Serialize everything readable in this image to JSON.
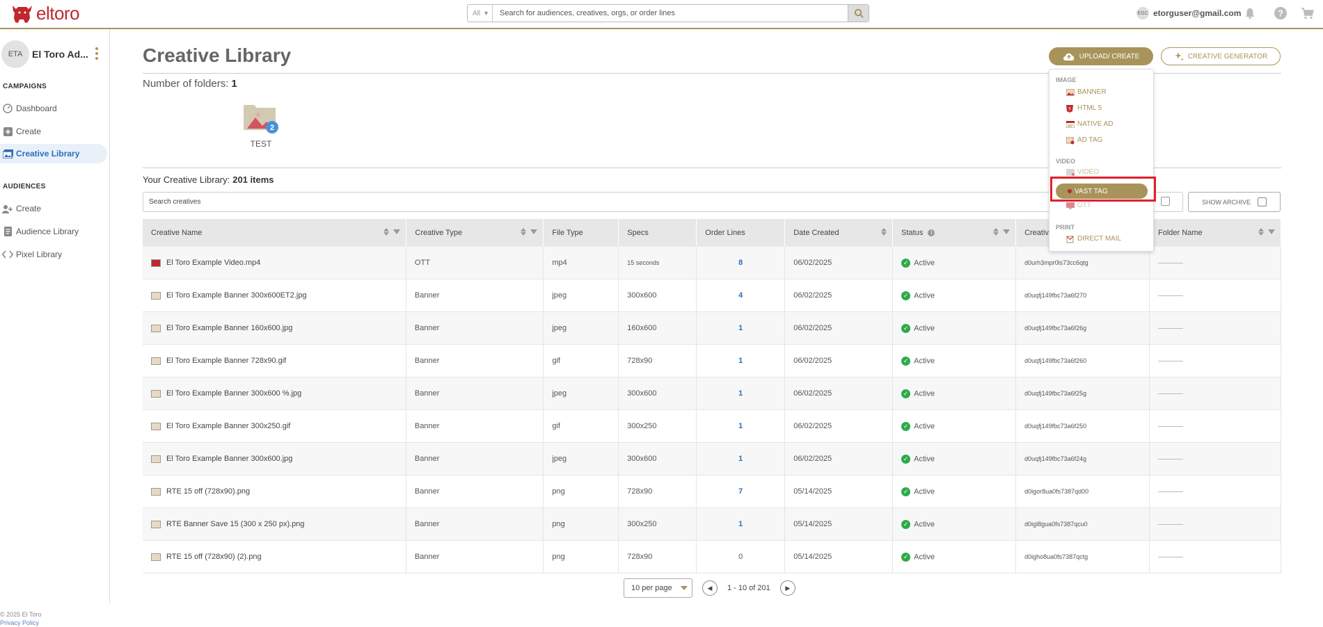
{
  "header": {
    "logo_text": "eltoro",
    "search": {
      "scope": "All",
      "placeholder": "Search for audiences, creatives, orgs, or order lines"
    },
    "user": {
      "initials": "EGC",
      "email": "etorguser@gmail.com"
    },
    "icons": [
      "bell-icon",
      "help-icon",
      "cart-icon"
    ]
  },
  "sidebar": {
    "org": {
      "initials": "ETA",
      "name": "El Toro Ad..."
    },
    "campaigns_label": "CAMPAIGNS",
    "campaigns": [
      {
        "label": "Dashboard",
        "icon": "dashboard-icon"
      },
      {
        "label": "Create",
        "icon": "plus-box-icon"
      },
      {
        "label": "Creative Library",
        "icon": "creative-library-icon",
        "active": true
      }
    ],
    "audiences_label": "AUDIENCES",
    "audiences": [
      {
        "label": "Create",
        "icon": "add-user-icon"
      },
      {
        "label": "Audience Library",
        "icon": "document-icon"
      },
      {
        "label": "Pixel Library",
        "icon": "code-icon"
      }
    ],
    "footer": {
      "copyright": "© 2025 El Toro",
      "privacy": "Privacy Policy"
    }
  },
  "main": {
    "title": "Creative Library",
    "upload_label": "UPLOAD/ CREATE",
    "generator_label": "CREATIVE GENERATOR",
    "folders_label": "Number of folders:",
    "folders_count": "1",
    "folder": {
      "name": "TEST",
      "badge": "2"
    },
    "library_label": "Your Creative Library:",
    "library_count": "201 items",
    "search_placeholder": "Search creatives",
    "show_archive": "SHOW ARCHIVE",
    "columns": [
      "Creative Name",
      "Creative Type",
      "File Type",
      "Specs",
      "Order Lines",
      "Date Created",
      "Status",
      "Creative ID",
      "Folder Name"
    ],
    "columns_visible": {
      "creative_id": "Creative"
    },
    "rows": [
      {
        "name": "El Toro Example Video.mp4",
        "type": "OTT",
        "file": "mp4",
        "specs": "15 seconds",
        "orders": "8",
        "date": "06/02/2025",
        "status": "Active",
        "id": "d0urh3mpr0ls73cc6qtg",
        "video": true
      },
      {
        "name": "El Toro Example Banner 300x600ET2.jpg",
        "type": "Banner",
        "file": "jpeg",
        "specs": "300x600",
        "orders": "4",
        "date": "06/02/2025",
        "status": "Active",
        "id": "d0uqfj149fbc73a6f270"
      },
      {
        "name": "El Toro Example Banner 160x600.jpg",
        "type": "Banner",
        "file": "jpeg",
        "specs": "160x600",
        "orders": "1",
        "date": "06/02/2025",
        "status": "Active",
        "id": "d0uqfj149fbc73a6f26g"
      },
      {
        "name": "El Toro Example Banner 728x90.gif",
        "type": "Banner",
        "file": "gif",
        "specs": "728x90",
        "orders": "1",
        "date": "06/02/2025",
        "status": "Active",
        "id": "d0uqfj149fbc73a6f260"
      },
      {
        "name": "El Toro Example Banner 300x600 %.jpg",
        "type": "Banner",
        "file": "jpeg",
        "specs": "300x600",
        "orders": "1",
        "date": "06/02/2025",
        "status": "Active",
        "id": "d0uqfj149fbc73a6f25g"
      },
      {
        "name": "El Toro Example Banner 300x250.gif",
        "type": "Banner",
        "file": "gif",
        "specs": "300x250",
        "orders": "1",
        "date": "06/02/2025",
        "status": "Active",
        "id": "d0uqfj149fbc73a6f250"
      },
      {
        "name": "El Toro Example Banner 300x600.jpg",
        "type": "Banner",
        "file": "jpeg",
        "specs": "300x600",
        "orders": "1",
        "date": "06/02/2025",
        "status": "Active",
        "id": "d0uqfj149fbc73a6f24g"
      },
      {
        "name": "RTE 15 off (728x90).png",
        "type": "Banner",
        "file": "png",
        "specs": "728x90",
        "orders": "7",
        "date": "05/14/2025",
        "status": "Active",
        "id": "d0igor8ua0fs7387qd00"
      },
      {
        "name": "RTE Banner Save 15 (300 x 250 px).png",
        "type": "Banner",
        "file": "png",
        "specs": "300x250",
        "orders": "1",
        "date": "05/14/2025",
        "status": "Active",
        "id": "d0igl8gua0fs7387qcu0"
      },
      {
        "name": "RTE 15 off (728x90) (2).png",
        "type": "Banner",
        "file": "png",
        "specs": "728x90",
        "orders": "0",
        "date": "05/14/2025",
        "status": "Active",
        "id": "d0igho8ua0fs7387qctg"
      }
    ],
    "pagination": {
      "per_page": "10 per page",
      "range": "1 - 10 of 201"
    }
  },
  "dropdown": {
    "image_label": "IMAGE",
    "image_items": [
      "BANNER",
      "HTML 5",
      "NATIVE AD",
      "AD TAG"
    ],
    "video_label": "VIDEO",
    "video_items": [
      "VIDEO",
      "VAST TAG",
      "OTT"
    ],
    "print_label": "PRINT",
    "print_items": [
      "DIRECT MAIL"
    ],
    "highlighted": "VAST TAG"
  },
  "colors": {
    "brand_gold": "#a8945a",
    "brand_red": "#c0282d",
    "active_blue": "#2d6dbb",
    "status_green": "#2eaa4a",
    "highlight_red": "#e0202e"
  }
}
